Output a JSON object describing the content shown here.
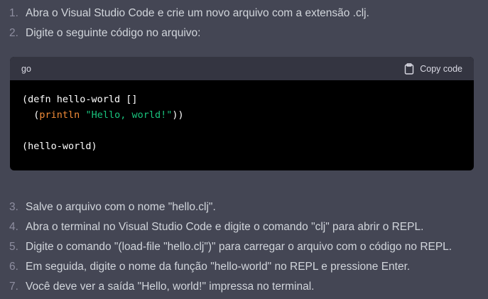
{
  "steps_top": [
    {
      "num": "1.",
      "text": "Abra o Visual Studio Code e crie um novo arquivo com a extensão .clj."
    },
    {
      "num": "2.",
      "text": "Digite o seguinte código no arquivo:"
    }
  ],
  "code": {
    "language": "go",
    "copy_label": "Copy code",
    "line1": "(defn hello-world []",
    "line2_indent": "  (",
    "line2_fn": "println",
    "line2_space": " ",
    "line2_str": "\"Hello, world!\"",
    "line2_close": "))",
    "line4": "(hello-world)"
  },
  "steps_bottom": [
    {
      "num": "3.",
      "text": "Salve o arquivo com o nome \"hello.clj\"."
    },
    {
      "num": "4.",
      "text": "Abra o terminal no Visual Studio Code e digite o comando \"clj\" para abrir o REPL."
    },
    {
      "num": "5.",
      "text": "Digite o comando \"(load-file \"hello.clj\")\" para carregar o arquivo com o código no REPL."
    },
    {
      "num": "6.",
      "text": "Em seguida, digite o nome da função \"hello-world\" no REPL e pressione Enter."
    },
    {
      "num": "7.",
      "text": "Você deve ver a saída \"Hello, world!\" impressa no terminal."
    }
  ]
}
